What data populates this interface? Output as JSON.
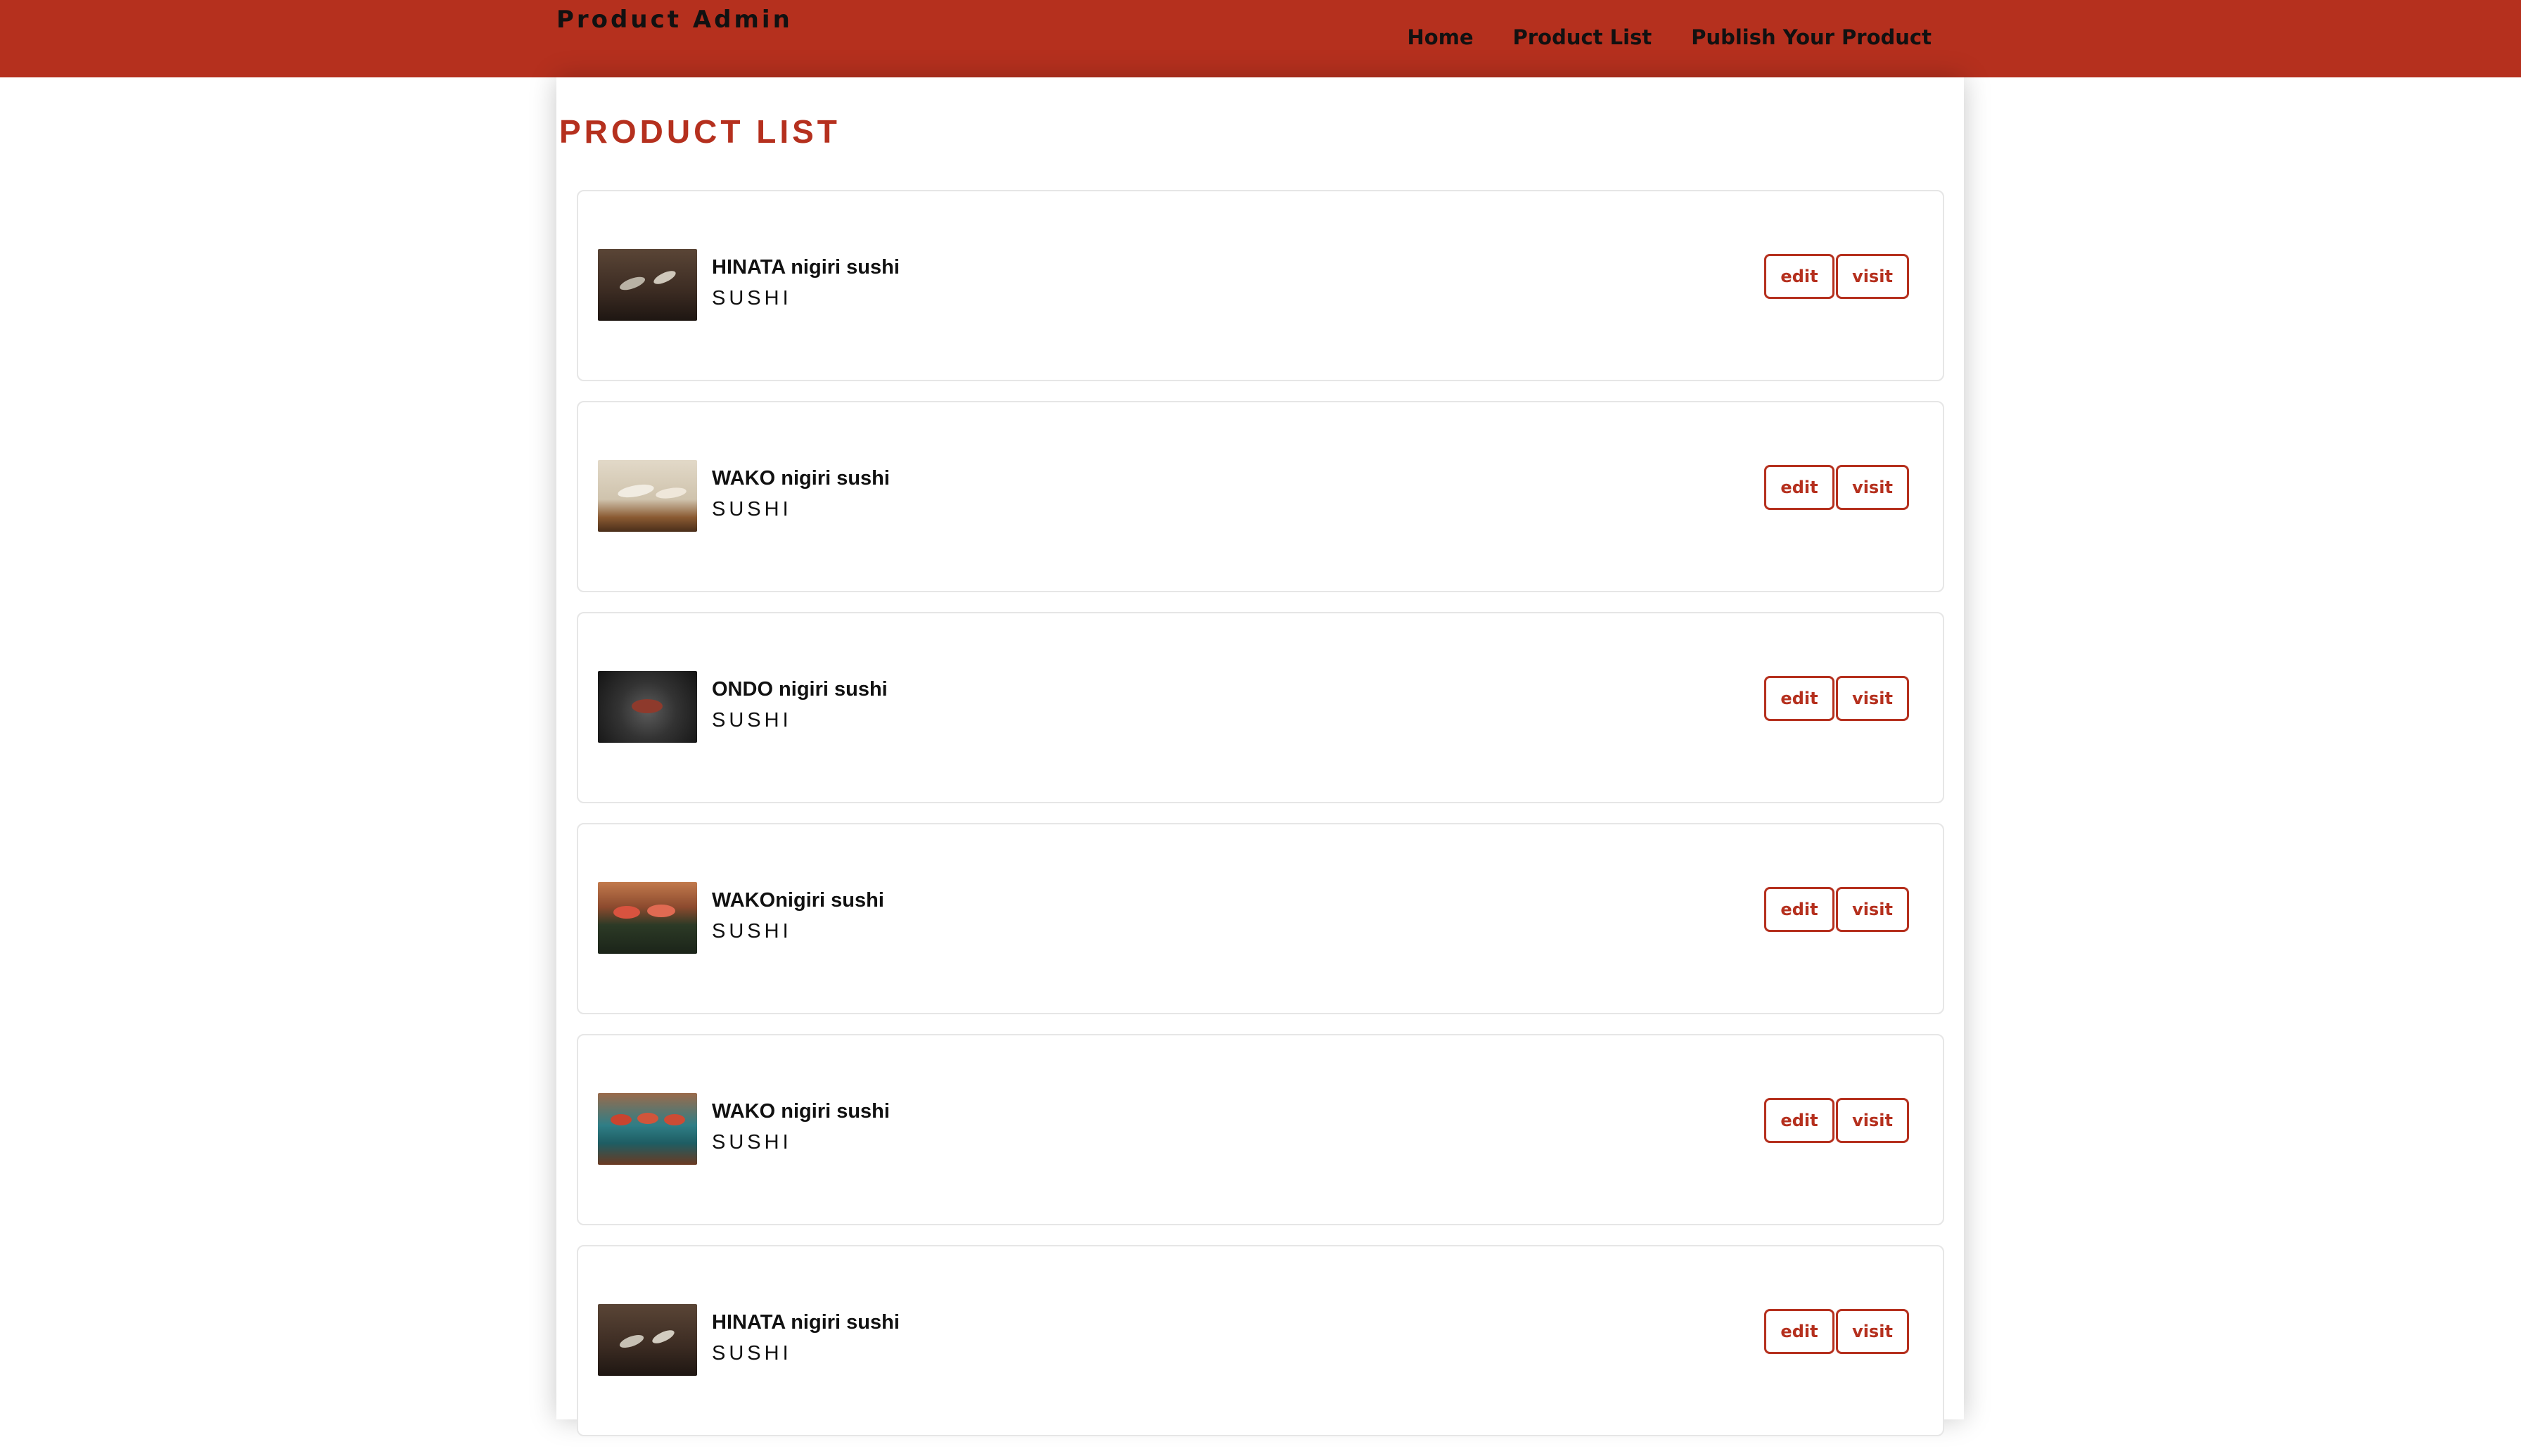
{
  "header": {
    "brand": "Product Admin",
    "nav": [
      {
        "label": "Home"
      },
      {
        "label": "Product List"
      },
      {
        "label": "Publish Your Product"
      }
    ]
  },
  "main": {
    "title": "PRODUCT LIST",
    "products": [
      {
        "name": "HINATA nigiri sushi",
        "category": "SUSHI",
        "edit_label": "edit",
        "visit_label": "visit"
      },
      {
        "name": "WAKO nigiri sushi",
        "category": "SUSHI",
        "edit_label": "edit",
        "visit_label": "visit"
      },
      {
        "name": "ONDO nigiri sushi",
        "category": "SUSHI",
        "edit_label": "edit",
        "visit_label": "visit"
      },
      {
        "name": "WAKOnigiri sushi",
        "category": "SUSHI",
        "edit_label": "edit",
        "visit_label": "visit"
      },
      {
        "name": "WAKO nigiri sushi",
        "category": "SUSHI",
        "edit_label": "edit",
        "visit_label": "visit"
      },
      {
        "name": "HINATA nigiri sushi",
        "category": "SUSHI",
        "edit_label": "edit",
        "visit_label": "visit"
      }
    ]
  },
  "colors": {
    "accent": "#b5301e",
    "card_border": "#e6e6e6"
  }
}
